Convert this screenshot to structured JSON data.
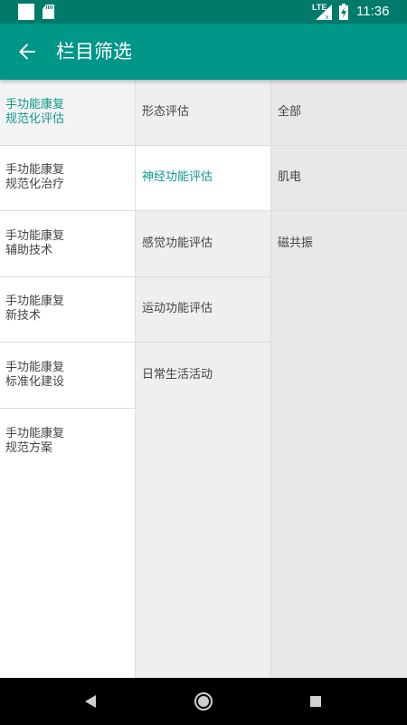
{
  "status_bar": {
    "network": "LTE",
    "time": "11:36"
  },
  "app_bar": {
    "title": "栏目筛选",
    "back_icon": "arrow-back-icon"
  },
  "columns": {
    "level1": [
      {
        "label": "手功能康复\n规范化评估",
        "selected": true
      },
      {
        "label": "手功能康复\n规范化治疗",
        "selected": false
      },
      {
        "label": "手功能康复\n辅助技术",
        "selected": false
      },
      {
        "label": "手功能康复\n新技术",
        "selected": false
      },
      {
        "label": "手功能康复\n标准化建设",
        "selected": false
      },
      {
        "label": "手功能康复\n规范方案",
        "selected": false
      }
    ],
    "level2": [
      {
        "label": "形态评估",
        "selected": false
      },
      {
        "label": "神经功能评估",
        "selected": true
      },
      {
        "label": "感觉功能评估",
        "selected": false
      },
      {
        "label": "运动功能评估",
        "selected": false
      },
      {
        "label": "日常生活活动",
        "selected": false
      }
    ],
    "level3": [
      {
        "label": "全部"
      },
      {
        "label": "肌电"
      },
      {
        "label": "磁共振"
      }
    ]
  },
  "colors": {
    "status_bar": "#007a6b",
    "app_bar": "#009688",
    "accent_text": "#0d9a88"
  },
  "nav_bar": {
    "back_icon": "nav-back-icon",
    "home_icon": "nav-home-icon",
    "recents_icon": "nav-recents-icon"
  }
}
